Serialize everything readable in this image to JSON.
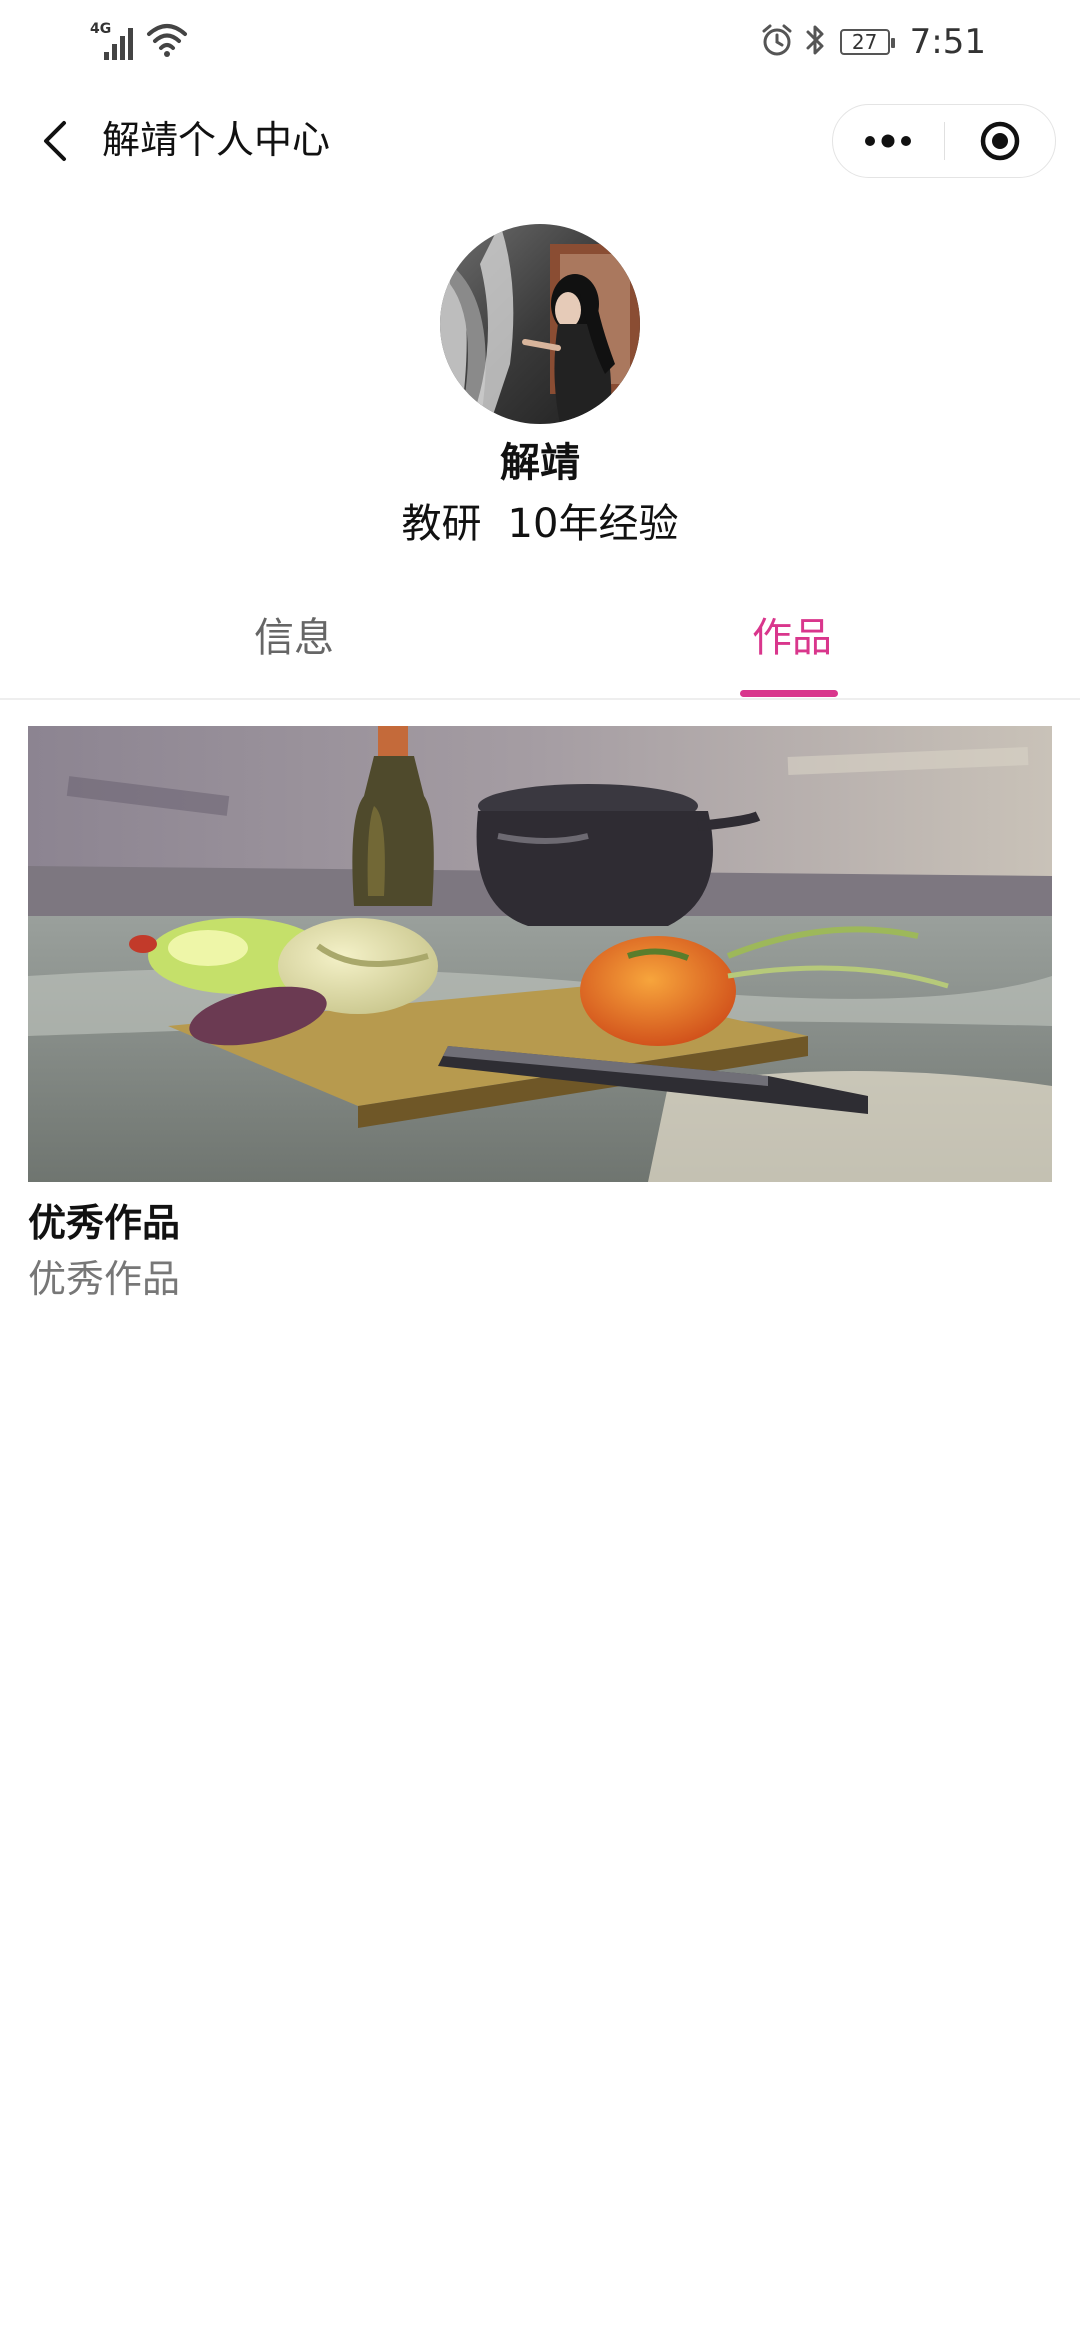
{
  "status_bar": {
    "network": "4G",
    "battery": "27",
    "time": "7:51"
  },
  "nav": {
    "title": "解靖个人中心"
  },
  "profile": {
    "name": "解靖",
    "role": "教研",
    "experience": "10年经验"
  },
  "tabs": [
    {
      "label": "信息",
      "active": false
    },
    {
      "label": "作品",
      "active": true
    }
  ],
  "works": [
    {
      "title": "优秀作品",
      "description": "优秀作品"
    }
  ],
  "colors": {
    "accent": "#d9368c",
    "text_primary": "#111111",
    "text_secondary": "#777777"
  }
}
